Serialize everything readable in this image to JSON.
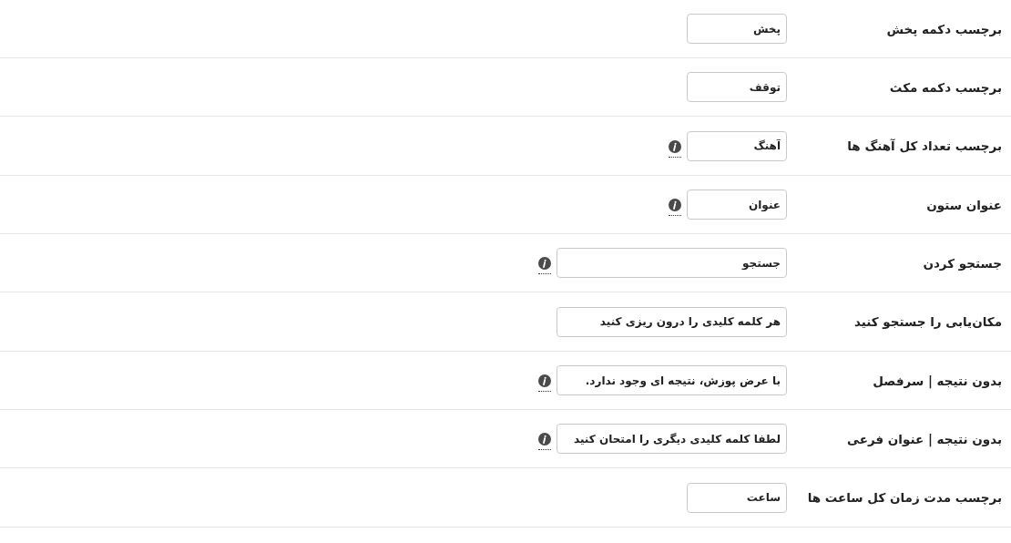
{
  "settings": [
    {
      "label": "برچسب دکمه پخش",
      "value": "پخش",
      "kind": "short",
      "info": false
    },
    {
      "label": "برچسب دکمه مکث",
      "value": "توقف",
      "kind": "short",
      "info": false
    },
    {
      "label": "برچسب تعداد کل آهنگ ها",
      "value": "آهنگ",
      "kind": "short",
      "info": true
    },
    {
      "label": "عنوان ستون",
      "value": "عنوان",
      "kind": "short",
      "info": true
    },
    {
      "label": "جستجو کردن",
      "value": "جستجو",
      "kind": "long",
      "info": true
    },
    {
      "label": "مکان‌یابی را جستجو کنید",
      "value": "هر کلمه کلیدی را درون ریزی کنید",
      "kind": "long",
      "info": false
    },
    {
      "label": "بدون نتیجه | سرفصل",
      "value": "با عرض پوزش، نتیجه ای وجود ندارد.",
      "kind": "long",
      "info": true
    },
    {
      "label": "بدون نتیجه | عنوان فرعی",
      "value": "لطفا کلمه کلیدی دیگری را امتحان کنید",
      "kind": "long",
      "info": true
    },
    {
      "label": "برچسب مدت زمان کل ساعت ها",
      "value": "ساعت",
      "kind": "short",
      "info": false
    }
  ]
}
